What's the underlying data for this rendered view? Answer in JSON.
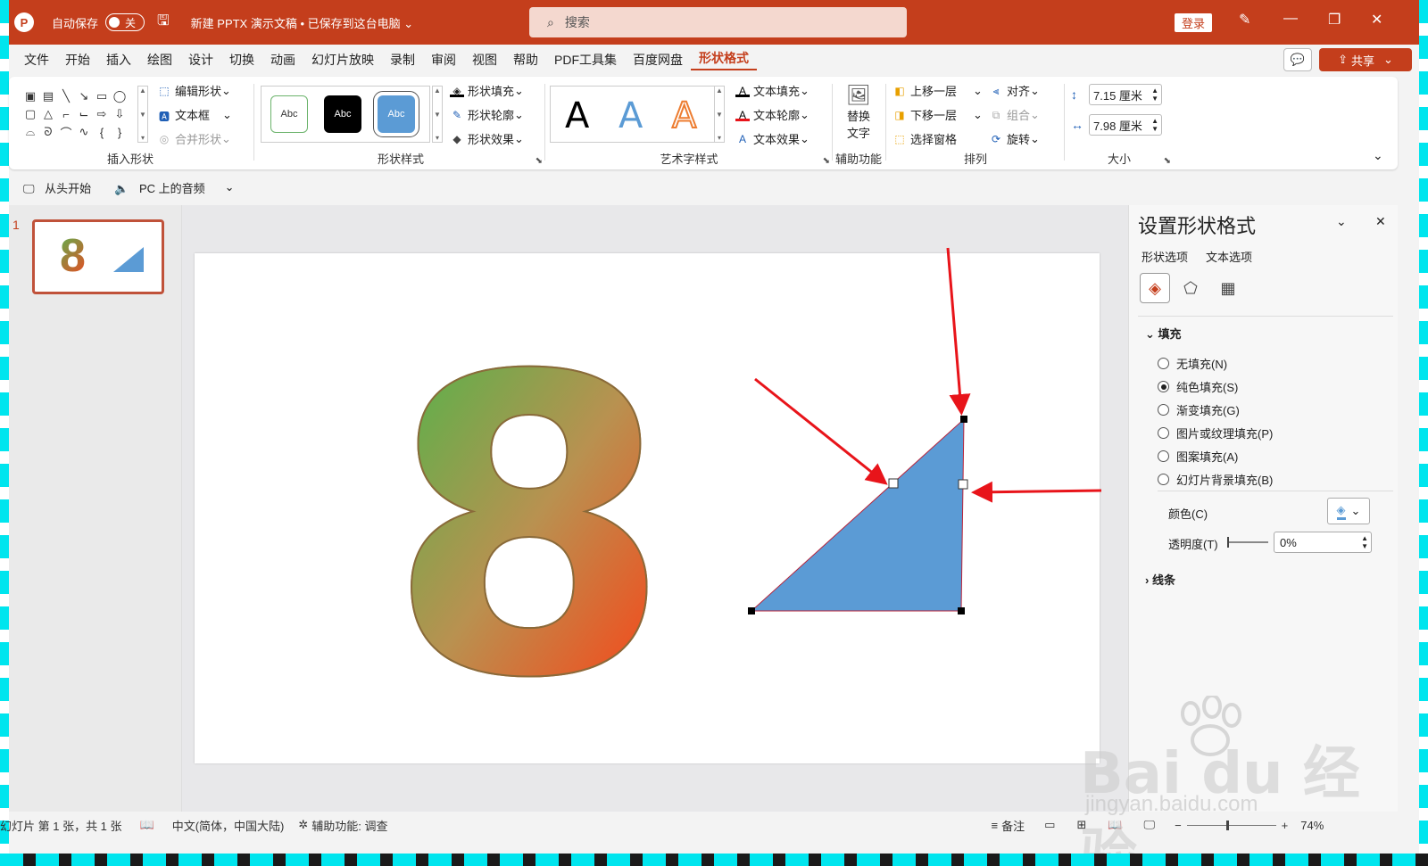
{
  "titlebar": {
    "logo_letter": "P",
    "autosave_label": "自动保存",
    "toggle_state": "关",
    "doc_title": "新建 PPTX 演示文稿 • 已保存到这台电脑 ⌄",
    "search_placeholder": "搜索",
    "login_label": "登录"
  },
  "menu": {
    "items": [
      "文件",
      "开始",
      "插入",
      "绘图",
      "设计",
      "切换",
      "动画",
      "幻灯片放映",
      "录制",
      "审阅",
      "视图",
      "帮助",
      "PDF工具集",
      "百度网盘",
      "形状格式"
    ],
    "active_index": 14,
    "share_label": "共享"
  },
  "ribbon": {
    "insert_shapes": {
      "label": "插入形状",
      "edit_shape": "编辑形状",
      "text_box": "文本框",
      "merge_shapes": "合并形状"
    },
    "shape_styles": {
      "label": "形状样式",
      "samples": [
        "Abc",
        "Abc",
        "Abc"
      ],
      "fill": "形状填充",
      "outline": "形状轮廓",
      "effects": "形状效果"
    },
    "wordart": {
      "label": "艺术字样式",
      "samples": [
        "A",
        "A",
        "A"
      ],
      "text_fill": "文本填充",
      "text_outline": "文本轮廓",
      "text_effects": "文本效果"
    },
    "accessibility": {
      "label": "辅助功能",
      "alt_text_1": "替换",
      "alt_text_2": "文字"
    },
    "arrange": {
      "label": "排列",
      "bring_forward": "上移一层",
      "send_backward": "下移一层",
      "selection_pane": "选择窗格",
      "align": "对齐",
      "group": "组合",
      "rotate": "旋转"
    },
    "size": {
      "label": "大小",
      "height": "7.15 厘米",
      "width": "7.98 厘米"
    }
  },
  "qat": {
    "from_start": "从头开始",
    "audio": "PC 上的音频"
  },
  "thumbnails": {
    "slide_number": "1",
    "thumb_text": "8"
  },
  "slide": {
    "big_text": "8",
    "triangle_color": "#5b9bd5"
  },
  "format_pane": {
    "title": "设置形状格式",
    "tab_shape": "形状选项",
    "tab_text": "文本选项",
    "fill_section": "填充",
    "fill_options": [
      "无填充(N)",
      "纯色填充(S)",
      "渐变填充(G)",
      "图片或纹理填充(P)",
      "图案填充(A)",
      "幻灯片背景填充(B)"
    ],
    "selected_fill_index": 1,
    "color_label": "颜色(C)",
    "transparency_label": "透明度(T)",
    "transparency_value": "0%",
    "line_section": "线条"
  },
  "statusbar": {
    "slide_info": "幻灯片 第 1 张，共 1 张",
    "language": "中文(简体，中国大陆)",
    "accessibility": "辅助功能: 调查",
    "notes": "备注",
    "zoom": "74%"
  },
  "watermark": {
    "brand": "Bai du 经验",
    "url": "jingyan.baidu.com"
  },
  "colors": {
    "accent": "#c43e1c",
    "arrow": "#e8141a"
  }
}
